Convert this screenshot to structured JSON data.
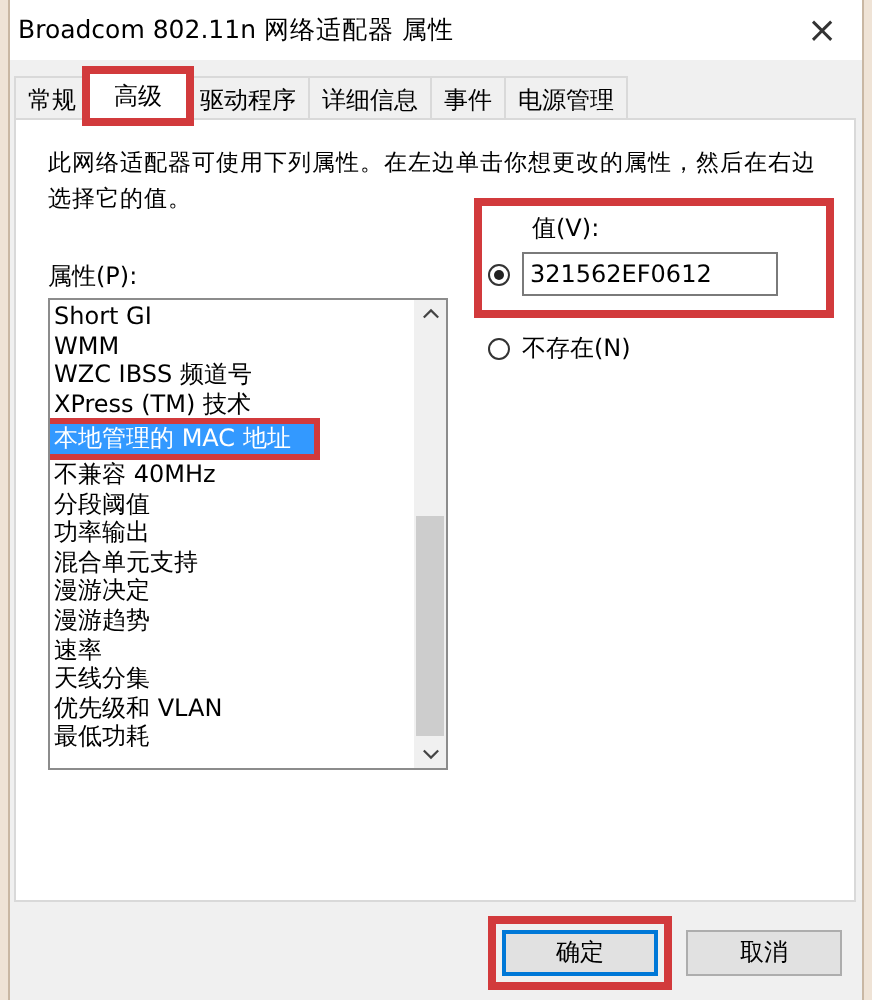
{
  "window": {
    "title": "Broadcom 802.11n 网络适配器 属性",
    "close": "×"
  },
  "tabs": [
    {
      "label": "常规",
      "selected": false,
      "highlighted": false
    },
    {
      "label": "高级",
      "selected": true,
      "highlighted": true
    },
    {
      "label": "驱动程序",
      "selected": false,
      "highlighted": false
    },
    {
      "label": "详细信息",
      "selected": false,
      "highlighted": false
    },
    {
      "label": "事件",
      "selected": false,
      "highlighted": false
    },
    {
      "label": "电源管理",
      "selected": false,
      "highlighted": false
    }
  ],
  "description": "此网络适配器可使用下列属性。在左边单击你想更改的属性，然后在右边选择它的值。",
  "property_list": {
    "label": "属性(P):",
    "items": [
      {
        "label": "Short GI",
        "selected": false,
        "highlighted": false
      },
      {
        "label": "WMM",
        "selected": false,
        "highlighted": false
      },
      {
        "label": "WZC IBSS 频道号",
        "selected": false,
        "highlighted": false
      },
      {
        "label": "XPress (TM) 技术",
        "selected": false,
        "highlighted": false
      },
      {
        "label": "本地管理的 MAC 地址",
        "selected": true,
        "highlighted": true
      },
      {
        "label": "不兼容 40MHz",
        "selected": false,
        "highlighted": false
      },
      {
        "label": "分段阈值",
        "selected": false,
        "highlighted": false
      },
      {
        "label": "功率输出",
        "selected": false,
        "highlighted": false
      },
      {
        "label": "混合单元支持",
        "selected": false,
        "highlighted": false
      },
      {
        "label": "漫游决定",
        "selected": false,
        "highlighted": false
      },
      {
        "label": "漫游趋势",
        "selected": false,
        "highlighted": false
      },
      {
        "label": "速率",
        "selected": false,
        "highlighted": false
      },
      {
        "label": "天线分集",
        "selected": false,
        "highlighted": false
      },
      {
        "label": "优先级和 VLAN",
        "selected": false,
        "highlighted": false
      },
      {
        "label": "最低功耗",
        "selected": false,
        "highlighted": false
      }
    ]
  },
  "value_options": [
    {
      "kind": "field",
      "label": "值(V):",
      "value": "321562EF0612",
      "selected": true,
      "highlighted": true
    },
    {
      "kind": "plain",
      "label": "不存在(N)",
      "selected": false,
      "highlighted": false
    }
  ],
  "buttons": [
    {
      "label": "确定",
      "highlighted": true
    },
    {
      "label": "取消",
      "highlighted": false
    }
  ]
}
